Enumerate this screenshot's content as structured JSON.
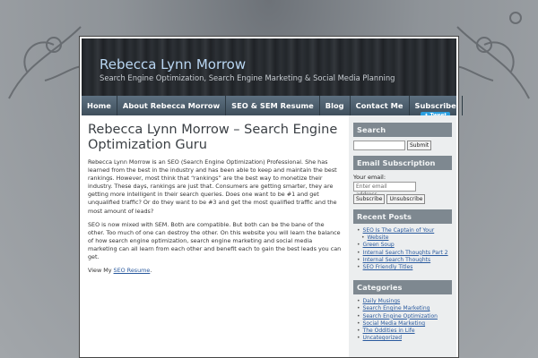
{
  "site": {
    "title": "Rebecca Lynn Morrow",
    "description": "Search Engine Optimization, Search Engine Marketing & Social Media Planning"
  },
  "nav": [
    {
      "label": "Home"
    },
    {
      "label": "About Rebecca Morrow"
    },
    {
      "label": "SEO & SEM Resume"
    },
    {
      "label": "Blog"
    },
    {
      "label": "Contact Me"
    },
    {
      "label": "Subscribe"
    }
  ],
  "post": {
    "title": "Rebecca Lynn Morrow – Search Engine Optimization Guru",
    "tweet_label": "Tweet",
    "paragraph1": "Rebecca Lynn Morrow is an SEO (Search Engine Optimization) Professional. She has learned from the best in the industry and has been able to keep and maintain the best rankings. However, most think that “rankings” are the best way to monetize their industry. These days, rankings are just that. Consumers are getting smarter, they are getting more intelligent in their search queries. Does one want to be #1 and get unqualified traffic? Or do they want to be #3 and get the most qualified traffic and the most amount of leads?",
    "paragraph2": "SEO is now mixed with SEM. Both are compatible. But both can be the bane of the other. Too much of one can destroy the other. On this website you will learn the balance of how search engine optimization, search engine marketing and social media marketing can all learn from each other and benefit each to gain the best leads you can get.",
    "view_prefix": "View My ",
    "view_link": "SEO Resume",
    "view_suffix": "."
  },
  "sidebar": {
    "search": {
      "title": "Search",
      "button": "Submit"
    },
    "email": {
      "title": "Email Subscription",
      "label": "Your email:",
      "placeholder": "Enter email address...",
      "subscribe": "Subscribe",
      "unsubscribe": "Unsubscribe"
    },
    "recent": {
      "title": "Recent Posts",
      "items": [
        "SEO Is The Captain of Your",
        "Website",
        "Green Soup",
        "Internal Search Thoughts Part 2",
        "Internal Search Thoughts",
        "SEO Friendly Titles"
      ]
    },
    "categories": {
      "title": "Categories",
      "items": [
        "Daily Musings",
        "Search Engine Marketing",
        "Search Engine Optimization",
        "Social Media Marketing",
        "The Oddities in Life",
        "Uncategorized"
      ]
    }
  }
}
